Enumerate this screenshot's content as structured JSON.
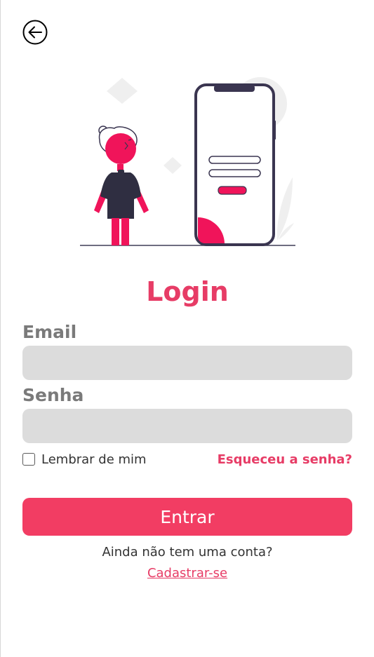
{
  "header": {
    "back_icon": "arrow-left-circle-icon"
  },
  "illustration": {
    "name": "login-mobile-illustration",
    "accent_color": "#f0145a",
    "dark_color": "#3a3550"
  },
  "form": {
    "title": "Login",
    "email": {
      "label": "Email",
      "value": "",
      "placeholder": ""
    },
    "password": {
      "label": "Senha",
      "value": "",
      "placeholder": ""
    },
    "remember": {
      "label": "Lembrar de mim",
      "checked": false
    },
    "forgot_label": "Esqueceu a senha?",
    "submit_label": "Entrar"
  },
  "footer": {
    "no_account_text": "Ainda não tem uma conta?",
    "signup_label": "Cadastrar-se"
  },
  "colors": {
    "accent": "#e73c66",
    "button": "#f23d63",
    "input_bg": "#dcdcdc",
    "label": "#7a7a7a"
  }
}
